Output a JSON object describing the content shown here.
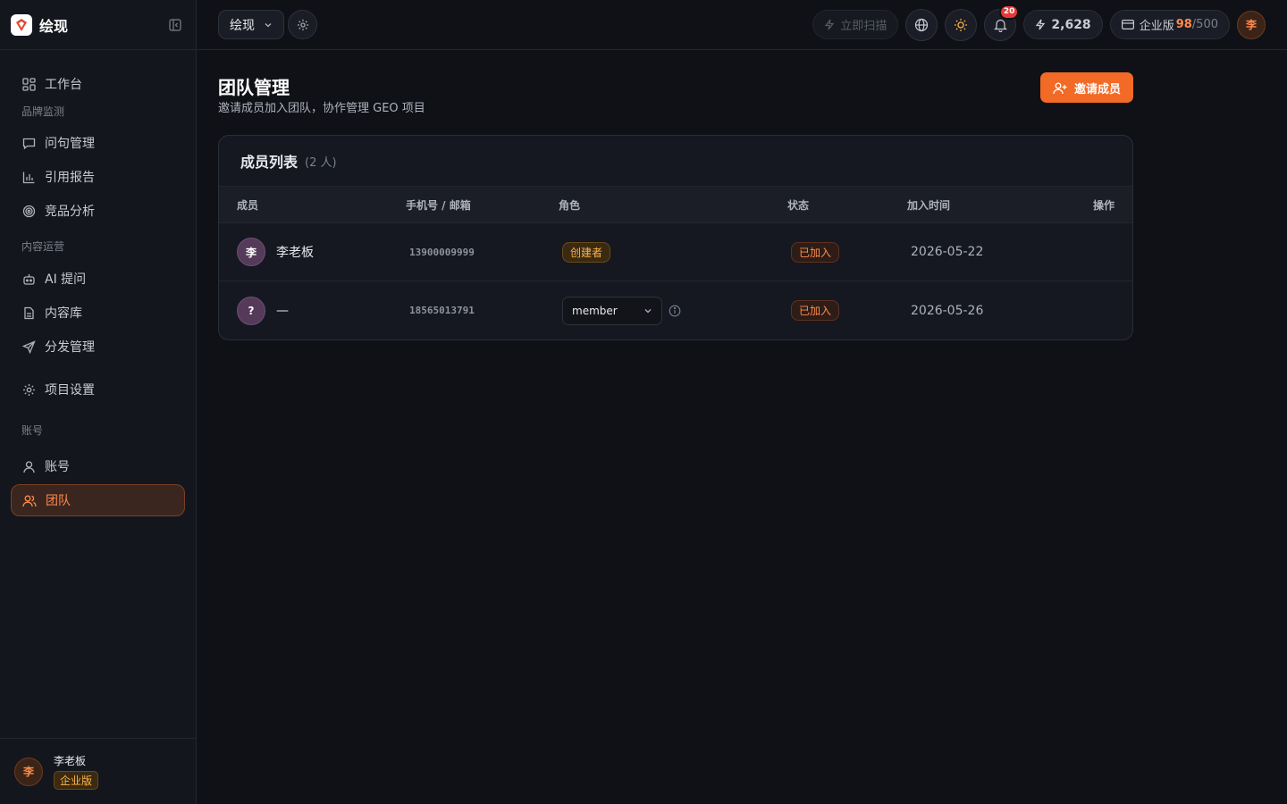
{
  "app": {
    "name": "绘现"
  },
  "sidebar": {
    "items": [
      {
        "label": "工作台"
      },
      {
        "section": "品牌监测"
      },
      {
        "label": "问句管理"
      },
      {
        "label": "引用报告"
      },
      {
        "label": "竞品分析"
      },
      {
        "section": "内容运营"
      },
      {
        "label": "AI 提问"
      },
      {
        "label": "内容库"
      },
      {
        "label": "分发管理"
      },
      {
        "label": "项目设置"
      },
      {
        "section": "账号"
      },
      {
        "label": "账号"
      },
      {
        "label": "团队"
      }
    ],
    "footer": {
      "avatar": "李",
      "name": "李老板",
      "plan": "企业版"
    }
  },
  "topbar": {
    "project": "绘现",
    "scan_label": "立即扫描",
    "notifications": "20",
    "credits": "2,628",
    "plan_name": "企业版",
    "plan_used": "98",
    "plan_total": "/500",
    "avatar": "李"
  },
  "page": {
    "title": "团队管理",
    "subtitle": "邀请成员加入团队，协作管理 GEO 项目",
    "invite_label": "邀请成员"
  },
  "members": {
    "title": "成员列表",
    "count": "(2 人)",
    "columns": [
      "成员",
      "手机号 / 邮箱",
      "角色",
      "状态",
      "加入时间",
      "操作"
    ],
    "rows": [
      {
        "avatar": "李",
        "name": "李老板",
        "phone": "13900009999",
        "role": "创建者",
        "status": "已加入",
        "joined": "2026-05-22"
      },
      {
        "avatar": "?",
        "name": "—",
        "phone": "18565013791",
        "role": "member",
        "status": "已加入",
        "joined": "2026-05-26"
      }
    ]
  },
  "colors": {
    "accent": "#f26a25",
    "background": "#0f1117",
    "sidebar": "#14161d",
    "creator_tag": "#ffb547"
  }
}
